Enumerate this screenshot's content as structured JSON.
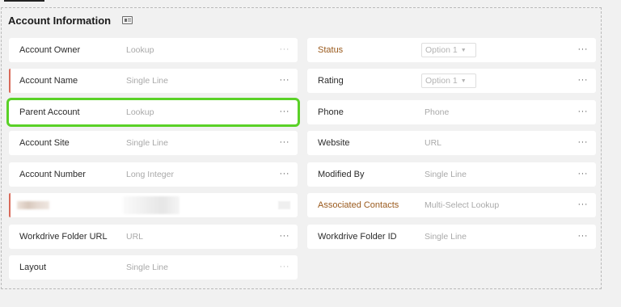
{
  "section": {
    "title": "Account Information",
    "icon": "card-layout-icon"
  },
  "left_fields": [
    {
      "label": "Account Owner",
      "type": "Lookup"
    },
    {
      "label": "Account Name",
      "type": "Single Line"
    },
    {
      "label": "Parent Account",
      "type": "Lookup"
    },
    {
      "label": "Account Site",
      "type": "Single Line"
    },
    {
      "label": "Account Number",
      "type": "Long Integer"
    },
    {
      "label": "Workdrive Folder URL",
      "type": "URL"
    },
    {
      "label": "Layout",
      "type": "Single Line"
    }
  ],
  "right_fields": [
    {
      "label": "Status",
      "select": "Option 1"
    },
    {
      "label": "Rating",
      "select": "Option 1"
    },
    {
      "label": "Phone",
      "type": "Phone"
    },
    {
      "label": "Website",
      "type": "URL"
    },
    {
      "label": "Modified By",
      "type": "Single Line"
    },
    {
      "label": "Associated Contacts",
      "type": "Multi-Select Lookup"
    },
    {
      "label": "Workdrive Folder ID",
      "type": "Single Line"
    }
  ],
  "more_icon": "···",
  "caret_icon": "▼",
  "colors": {
    "selection_outline": "#5ad127",
    "required_marker": "#d96a5a",
    "system_label": "#9a5a1d"
  }
}
